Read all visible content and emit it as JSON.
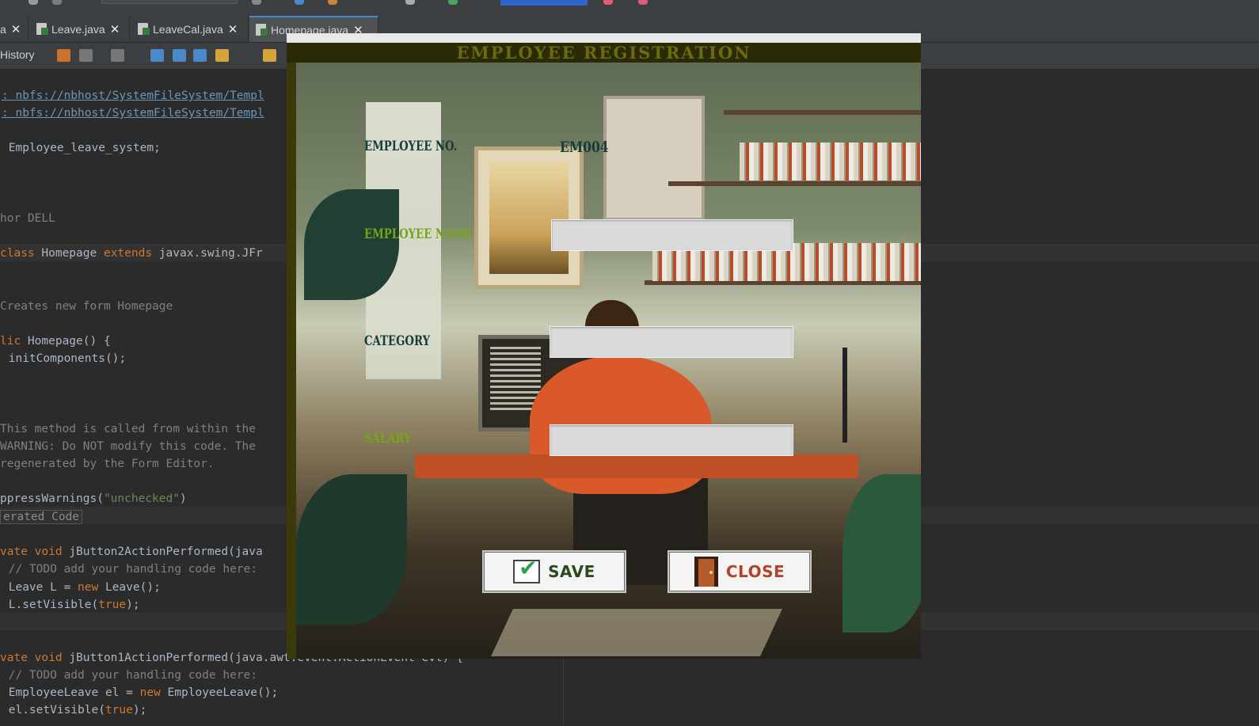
{
  "ide": {
    "tabs": [
      {
        "label": "a"
      },
      {
        "label": "Leave.java"
      },
      {
        "label": "LeaveCal.java"
      },
      {
        "label": "Homepage.java"
      }
    ],
    "close_glyph": "✕",
    "toolbar": {
      "history_label": "History"
    },
    "code_lines": [
      {
        "text": ": nbfs://nbhost/SystemFileSystem/Templ"
      },
      {
        "text": ": nbfs://nbhost/SystemFileSystem/Templ"
      },
      {
        "text": " Employee_leave_system;"
      },
      {
        "text": "hor DELL"
      },
      {
        "kw": "class",
        "text": " Homepage ",
        "kw2": "extends",
        "rest": " javax.swing.JFr"
      },
      {
        "text": "Creates new form Homepage"
      },
      {
        "kw": "lic",
        "text": " Homepage() {"
      },
      {
        "text": " initComponents();"
      },
      {
        "text": "This method is called from within the"
      },
      {
        "text": "WARNING: Do NOT modify this code. The"
      },
      {
        "text": "regenerated by the Form Editor."
      },
      {
        "text": "ppressWarnings(",
        "str": "\"unchecked\"",
        "rest": ")"
      },
      {
        "text": "erated Code"
      },
      {
        "kw": "vate void",
        "text": " jButton2ActionPerformed(java"
      },
      {
        "text": " // TODO add your handling code here:"
      },
      {
        "text": " Leave L = ",
        "kw": "new",
        "rest": " Leave();"
      },
      {
        "text": " L.setVisible(",
        "kw": "true",
        "rest": ");"
      },
      {
        "kw": "vate void",
        "text": " jButton1ActionPerformed(java.awt.event.ActionEvent evt) {"
      },
      {
        "text": " // TODO add your handling code here:"
      },
      {
        "text": " EmployeeLeave el = ",
        "kw": "new",
        "rest": " EmployeeLeave();"
      },
      {
        "text": " el.setVisible(",
        "kw": "true",
        "rest": ");"
      }
    ]
  },
  "form": {
    "title": "EMPLOYEE REGISTRATION",
    "labels": {
      "employee_no": "EMPLOYEE NO.",
      "employee_name": "EMPLOYEE NAME",
      "category": "CATEGORY",
      "salary": "SALARY"
    },
    "employee_no_value": "EM004",
    "inputs": {
      "employee_name": "",
      "category": "",
      "salary": ""
    },
    "buttons": {
      "save": "SAVE",
      "close": "CLOSE"
    },
    "colors": {
      "title": "#6a6a10",
      "label_dark": "#173c3a",
      "label_green": "#77a31d",
      "save_text": "#2b4a1c",
      "close_text": "#b0432a"
    }
  }
}
